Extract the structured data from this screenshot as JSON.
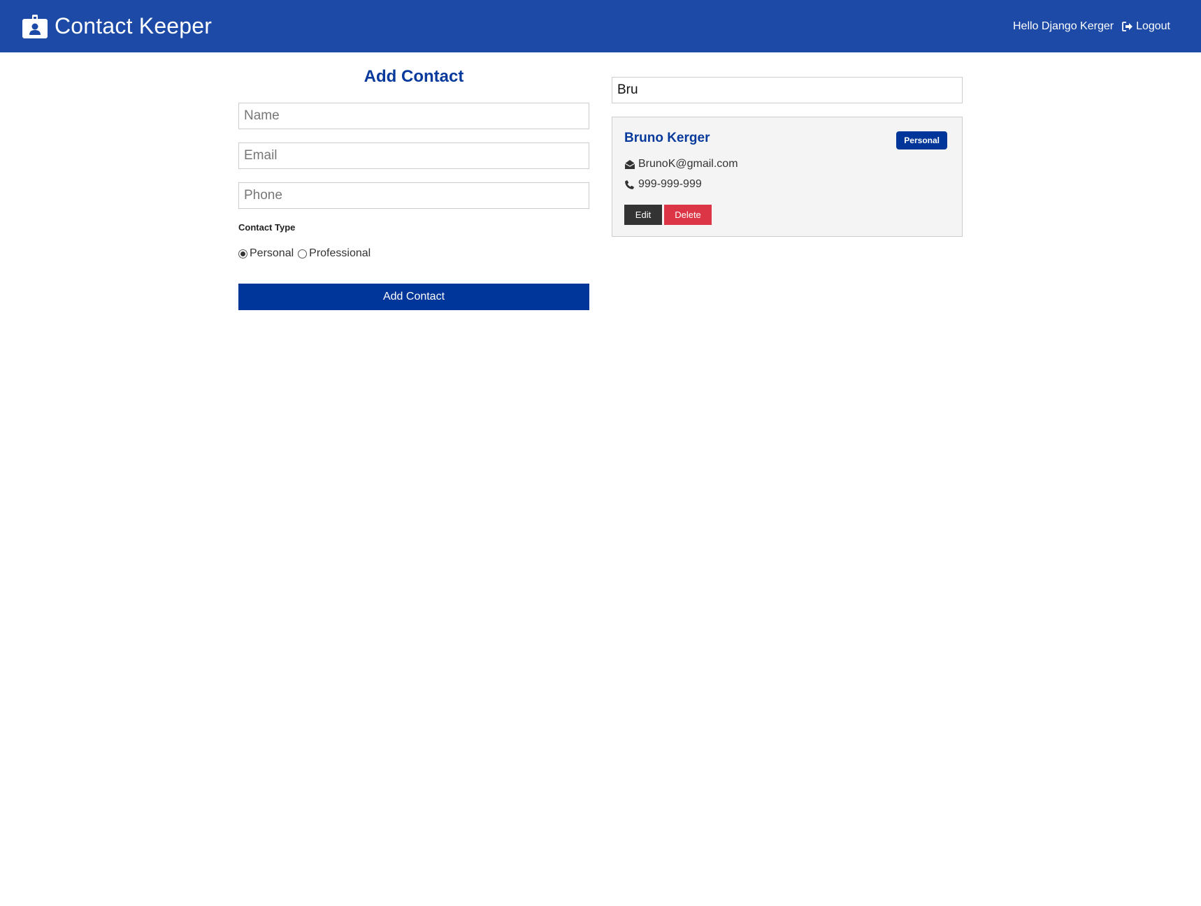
{
  "navbar": {
    "title": "Contact Keeper",
    "greeting": "Hello Django Kerger",
    "logout_label": "Logout",
    "brand_icon": "id-badge-icon",
    "logout_icon": "sign-out-icon",
    "color": "#1c4aa6"
  },
  "form": {
    "title": "Add Contact",
    "name_placeholder": "Name",
    "email_placeholder": "Email",
    "phone_placeholder": "Phone",
    "contact_type_label": "Contact Type",
    "options": [
      {
        "label": "Personal",
        "checked": true
      },
      {
        "label": "Professional",
        "checked": false
      }
    ],
    "submit_label": "Add Contact"
  },
  "search": {
    "value": "Bru"
  },
  "contacts": [
    {
      "name": "Bruno Kerger",
      "type": "Personal",
      "email": "BrunoK@gmail.com",
      "phone": "999-999-999",
      "edit_label": "Edit",
      "delete_label": "Delete"
    }
  ],
  "colors": {
    "primary": "#003699",
    "danger": "#dc3545",
    "dark": "#333333"
  }
}
